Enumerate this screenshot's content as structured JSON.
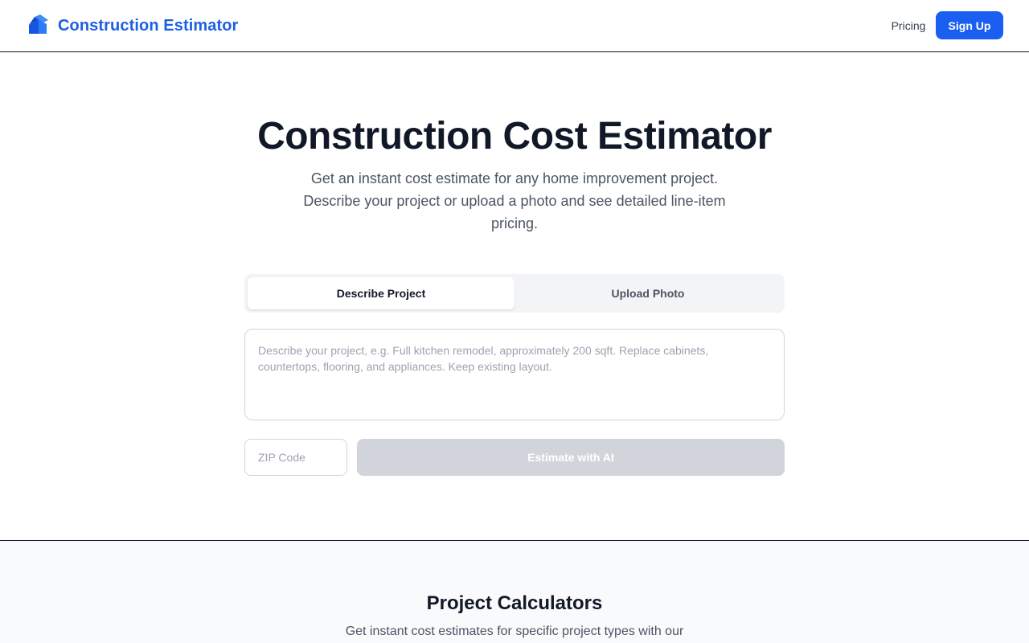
{
  "header": {
    "brand_name": "Construction Estimator",
    "brand_icon": "house-cube-icon",
    "nav_pricing": "Pricing",
    "signup_label": "Sign Up"
  },
  "hero": {
    "title": "Construction Cost Estimator",
    "subtitle": "Get an instant cost estimate for any home improvement project. Describe your project or upload a photo and see detailed line-item pricing."
  },
  "tabs": [
    {
      "label": "Describe Project",
      "active": true
    },
    {
      "label": "Upload Photo",
      "active": false
    }
  ],
  "form": {
    "description_value": "",
    "description_placeholder": "Describe your project, e.g. Full kitchen remodel, approximately 200 sqft. Replace cabinets, countertops, flooring, and appliances. Keep existing layout.",
    "zip_value": "",
    "zip_placeholder": "ZIP Code",
    "submit_label": "Estimate with AI",
    "submit_disabled": true
  },
  "calculators": {
    "title": "Project Calculators",
    "subtitle": "Get instant cost estimates for specific project types with our"
  },
  "colors": {
    "brand": "#1d5fe6",
    "primary_button": "#1a5ff2",
    "disabled_button": "#d1d5db",
    "heading": "#111827",
    "body_text": "#4b5563"
  }
}
